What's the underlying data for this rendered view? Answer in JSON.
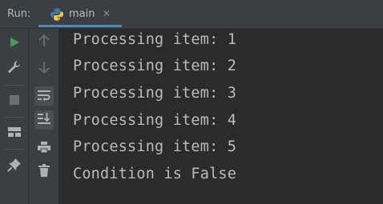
{
  "header": {
    "run_label": "Run:",
    "tab": {
      "label": "main",
      "close": "✕",
      "icon": "python-icon"
    }
  },
  "toolbar_left": [
    {
      "name": "rerun-icon",
      "color": "#499c54"
    },
    {
      "name": "wrench-icon",
      "color": "#afb1b3"
    },
    {
      "name": "stop-icon",
      "color": "#6e6e6e"
    },
    {
      "name": "layout-icon",
      "color": "#afb1b3"
    },
    {
      "name": "pin-icon",
      "color": "#afb1b3"
    }
  ],
  "toolbar_right": [
    {
      "name": "up-arrow-icon",
      "color": "#6e6e6e"
    },
    {
      "name": "down-arrow-icon",
      "color": "#6e6e6e"
    },
    {
      "name": "soft-wrap-icon",
      "color": "#afb1b3",
      "active": true
    },
    {
      "name": "scroll-to-end-icon",
      "color": "#afb1b3",
      "active": true
    },
    {
      "name": "print-icon",
      "color": "#afb1b3"
    },
    {
      "name": "trash-icon",
      "color": "#afb1b3"
    }
  ],
  "console": {
    "lines": [
      "Processing item: 1",
      "Processing item: 2",
      "Processing item: 3",
      "Processing item: 4",
      "Processing item: 5",
      "Condition is False"
    ]
  },
  "colors": {
    "background": "#2b2b2b",
    "panel": "#3c3f41",
    "text": "#bbbbbb",
    "accent": "#4a88c7"
  }
}
